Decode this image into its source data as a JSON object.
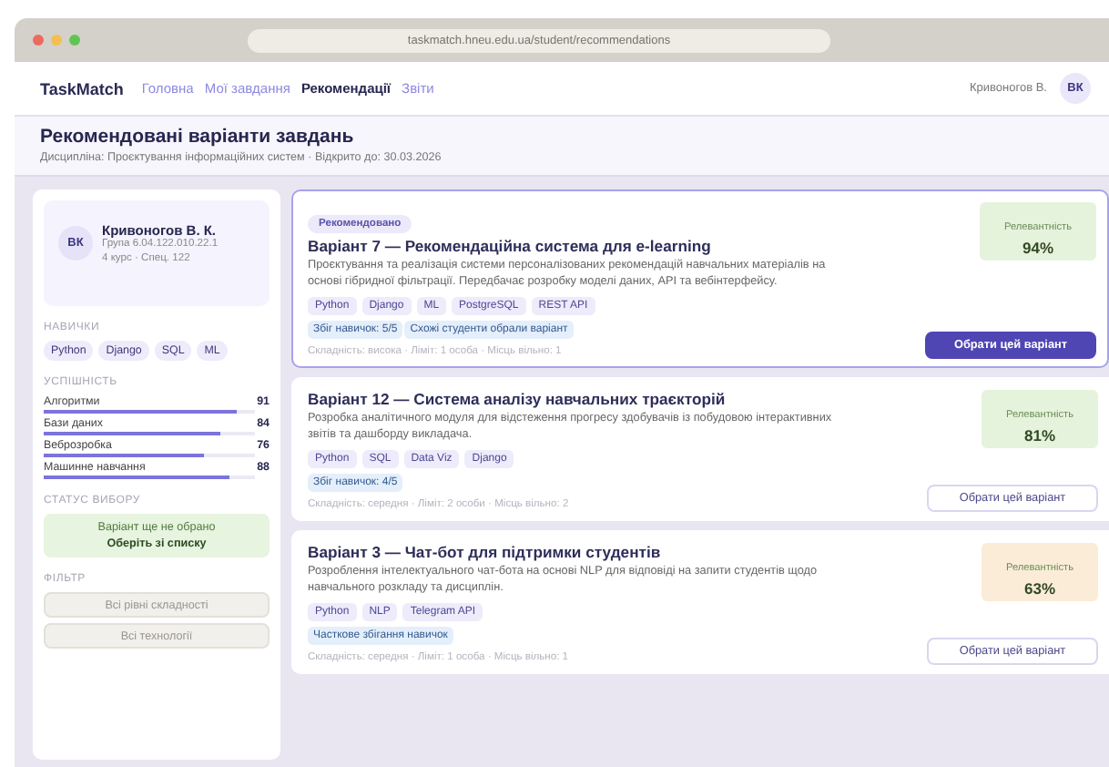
{
  "browser": {
    "url": "taskmatch.hneu.edu.ua/student/recommendations"
  },
  "nav": {
    "brand": "TaskMatch",
    "links": [
      {
        "label": "Головна",
        "selected": false
      },
      {
        "label": "Мої завдання",
        "selected": false
      },
      {
        "label": "Рекомендації",
        "selected": true
      },
      {
        "label": "Звіти",
        "selected": false
      }
    ],
    "user": "Кривоногов В.",
    "avatar": "ВК"
  },
  "header": {
    "title": "Рекомендовані варіанти завдань",
    "subtitle": "Дисципліна: Проєктування інформаційних систем · Відкрито до: 30.03.2026"
  },
  "sidebar": {
    "profile": {
      "avatar": "ВК",
      "name": "Кривоногов В. К.",
      "group": "Група 6.04.122.010.22.1",
      "course": "4 курс · Спец. 122"
    },
    "skills_title": "НАВИЧКИ",
    "skills": [
      "Python",
      "Django",
      "SQL",
      "ML"
    ],
    "performance_title": "УСПІШНІСТЬ",
    "performance": [
      {
        "name": "Алгоритми",
        "score": "91",
        "level": 0.91
      },
      {
        "name": "Бази даних",
        "score": "84",
        "level": 0.84
      },
      {
        "name": "Веброзробка",
        "score": "76",
        "level": 0.76
      },
      {
        "name": "Машинне навчання",
        "score": "88",
        "level": 0.88
      }
    ],
    "status_title": "СТАТУС ВИБОРУ",
    "status_text": "Варіант ще не обрано",
    "status_action": "Оберіть зі списку",
    "filter_title": "ФІЛЬТР",
    "filters": [
      "Всі рівні складності",
      "Всі технології"
    ]
  },
  "variants": [
    {
      "badge": "Рекомендовано",
      "title": "Варіант 7 — Рекомендаційна система для e-learning",
      "description": "Проєктування та реалізація системи персоналізованих рекомендацій навчальних матеріалів на основі гібридної фільтрації. Передбачає розробку моделі даних, API та вебінтерфейсу.",
      "tech": [
        "Python",
        "Django",
        "ML",
        "PostgreSQL",
        "REST API"
      ],
      "matches": [
        "Збіг навичок: 5/5",
        "Схожі студенти обрали варіант"
      ],
      "meta": "Складність: висока · Ліміт: 1 особа · Місць вільно: 1",
      "relevance_label": "Релевантність",
      "relevance": "94%",
      "color": "#e6f3dc",
      "selected": true,
      "button": "Обрати цей варіант"
    },
    {
      "title": "Варіант 12 — Система аналізу навчальних траєкторій",
      "description": "Розробка аналітичного модуля для відстеження прогресу здобувачів із побудовою інтерактивних звітів та дашборду викладача.",
      "tech": [
        "Python",
        "SQL",
        "Data Viz",
        "Django"
      ],
      "matches": [
        "Збіг навичок: 4/5"
      ],
      "meta": "Складність: середня · Ліміт: 2 особи · Місць вільно: 2",
      "relevance_label": "Релевантність",
      "relevance": "81%",
      "color": "#e6f3dc",
      "selected": false,
      "button": "Обрати цей варіант"
    },
    {
      "title": "Варіант 3 — Чат-бот для підтримки студентів",
      "description": "Розроблення інтелектуального чат-бота на основі NLP для відповіді на запити студентів щодо навчального розкладу та дисциплін.",
      "tech": [
        "Python",
        "NLP",
        "Telegram API"
      ],
      "matches": [
        "Часткове збігання навичок"
      ],
      "meta": "Складність: середня · Ліміт: 1 особа · Місць вільно: 1",
      "relevance_label": "Релевантність",
      "relevance": "63%",
      "color": "#fbecd8",
      "selected": false,
      "button": "Обрати цей варіант"
    }
  ]
}
